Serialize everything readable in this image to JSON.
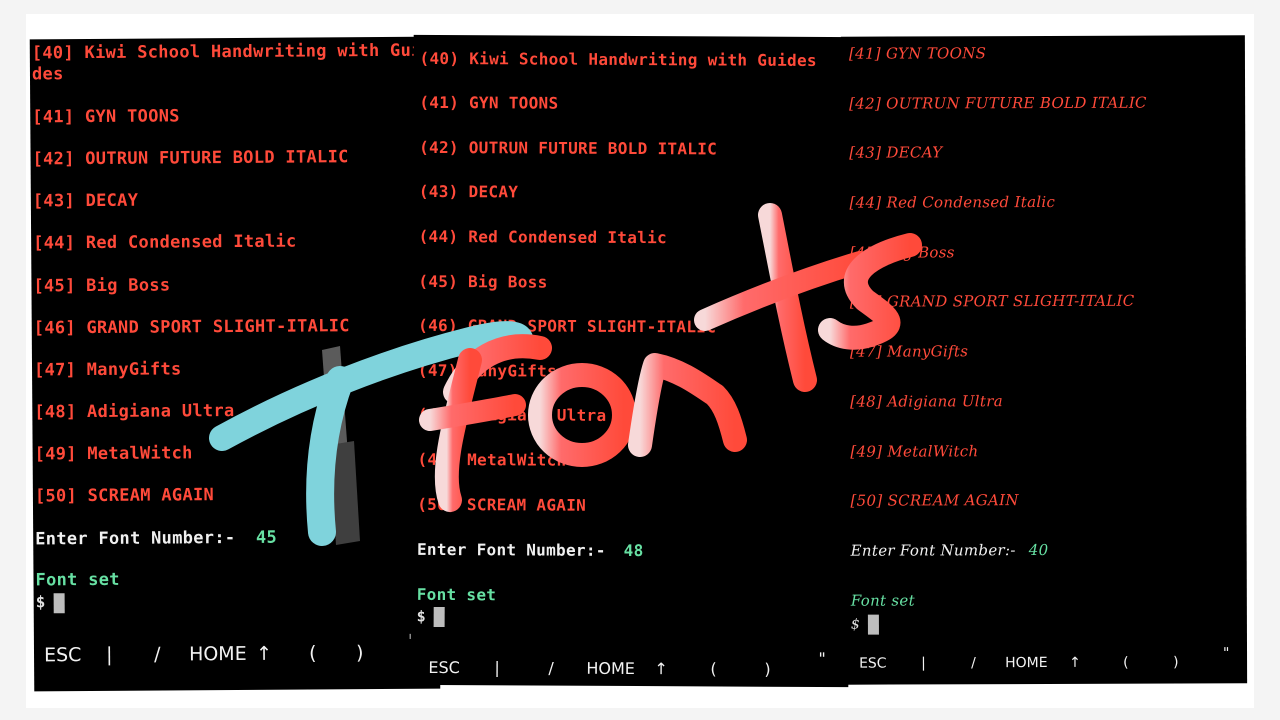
{
  "overlay_title": {
    "letter_t": "T",
    "letters_fonts": "Fonts"
  },
  "colors": {
    "font_red": "#ff4a3a",
    "prompt_green": "#67e0a3",
    "background": "#000000",
    "t_cyan": "#7fd3dc"
  },
  "panels": [
    {
      "items": [
        "[40] Kiwi School Handwriting with Guides",
        "[41] GYN TOONS",
        "[42] OUTRUN FUTURE BOLD ITALIC",
        "[43] DECAY",
        "[44] Red Condensed Italic",
        "[45] Big Boss",
        "[46] GRAND SPORT SLIGHT-ITALIC",
        "[47] ManyGifts",
        "[48] Adigiana Ultra",
        "[49] MetalWitch",
        "[50] SCREAM AGAIN"
      ],
      "prompt_label": "Enter Font Number:-",
      "prompt_value": "45",
      "status": "Font set",
      "shell": "$",
      "keys": [
        "ESC",
        "|",
        "/",
        "HOME",
        "↑",
        "(",
        ")",
        "\""
      ]
    },
    {
      "items": [
        "(40) Kiwi School Handwriting with Guides",
        "(41) GYN TOONS",
        "(42) OUTRUN FUTURE BOLD ITALIC",
        "(43) DECAY",
        "(44) Red Condensed Italic",
        "(45) Big Boss",
        "(46) GRAND SPORT SLIGHT-ITALIC",
        "(47) ManyGifts",
        "(48) Adigiana Ultra",
        "(49) MetalWitch",
        "(50) SCREAM AGAIN"
      ],
      "prompt_label": "Enter Font Number:-",
      "prompt_value": "48",
      "status": "Font set",
      "shell": "$",
      "keys": [
        "ESC",
        "|",
        "/",
        "HOME",
        "↑",
        "(",
        ")",
        "\""
      ]
    },
    {
      "items": [
        "[41] GYN TOONS",
        "[42] OUTRUN FUTURE BOLD ITALIC",
        "[43] DECAY",
        "[44] Red Condensed Italic",
        "[45] Big Boss",
        "[46] GRAND SPORT SLIGHT-ITALIC",
        "[47] ManyGifts",
        "[48] Adigiana Ultra",
        "[49] MetalWitch",
        "[50] SCREAM AGAIN"
      ],
      "prompt_label": "Enter Font Number:-",
      "prompt_value": "40",
      "status": "Font set",
      "shell": "$",
      "keys": [
        "ESC",
        "|",
        "/",
        "HOME",
        "↑",
        "(",
        ")",
        "\""
      ]
    }
  ]
}
